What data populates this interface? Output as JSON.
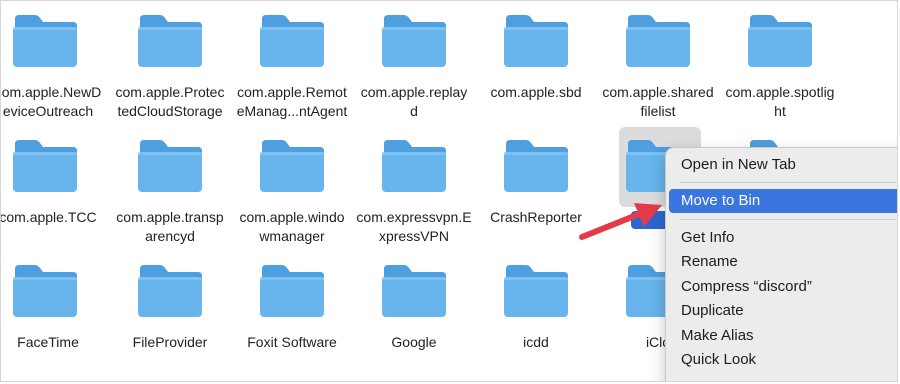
{
  "folders": [
    {
      "label": "com.apple.NewD\neviceOutreach"
    },
    {
      "label": "com.apple.Protec\ntedCloudStorage"
    },
    {
      "label": "com.apple.Remot\neManag...ntAgent"
    },
    {
      "label": "com.apple.replay\nd"
    },
    {
      "label": "com.apple.sbd"
    },
    {
      "label": "com.apple.shared\nfilelist"
    },
    {
      "label": "com.apple.spotlig\nht"
    },
    {
      "label": "com.apple.TCC"
    },
    {
      "label": "com.apple.transp\narencyd"
    },
    {
      "label": "com.apple.windo\nwmanager"
    },
    {
      "label": "com.expressvpn.E\nxpressVPN"
    },
    {
      "label": "CrashReporter"
    },
    {
      "label": "discord"
    },
    {
      "label": ""
    },
    {
      "label": "FaceTime"
    },
    {
      "label": "FileProvider"
    },
    {
      "label": "Foxit Software"
    },
    {
      "label": "Google"
    },
    {
      "label": "icdd"
    },
    {
      "label": "iClo"
    }
  ],
  "context_menu": {
    "items": [
      {
        "label": "Open in New Tab"
      },
      {
        "label": "Move to Bin",
        "highlighted": true
      },
      {
        "label": "Get Info"
      },
      {
        "label": "Rename"
      },
      {
        "label": "Compress “discord”"
      },
      {
        "label": "Duplicate"
      },
      {
        "label": "Make Alias"
      },
      {
        "label": "Quick Look"
      }
    ]
  },
  "colors": {
    "folder_body": "#67b5ec",
    "folder_tab": "#4d9fdf",
    "highlight": "#3a76e0",
    "arrow": "#e53a48"
  }
}
